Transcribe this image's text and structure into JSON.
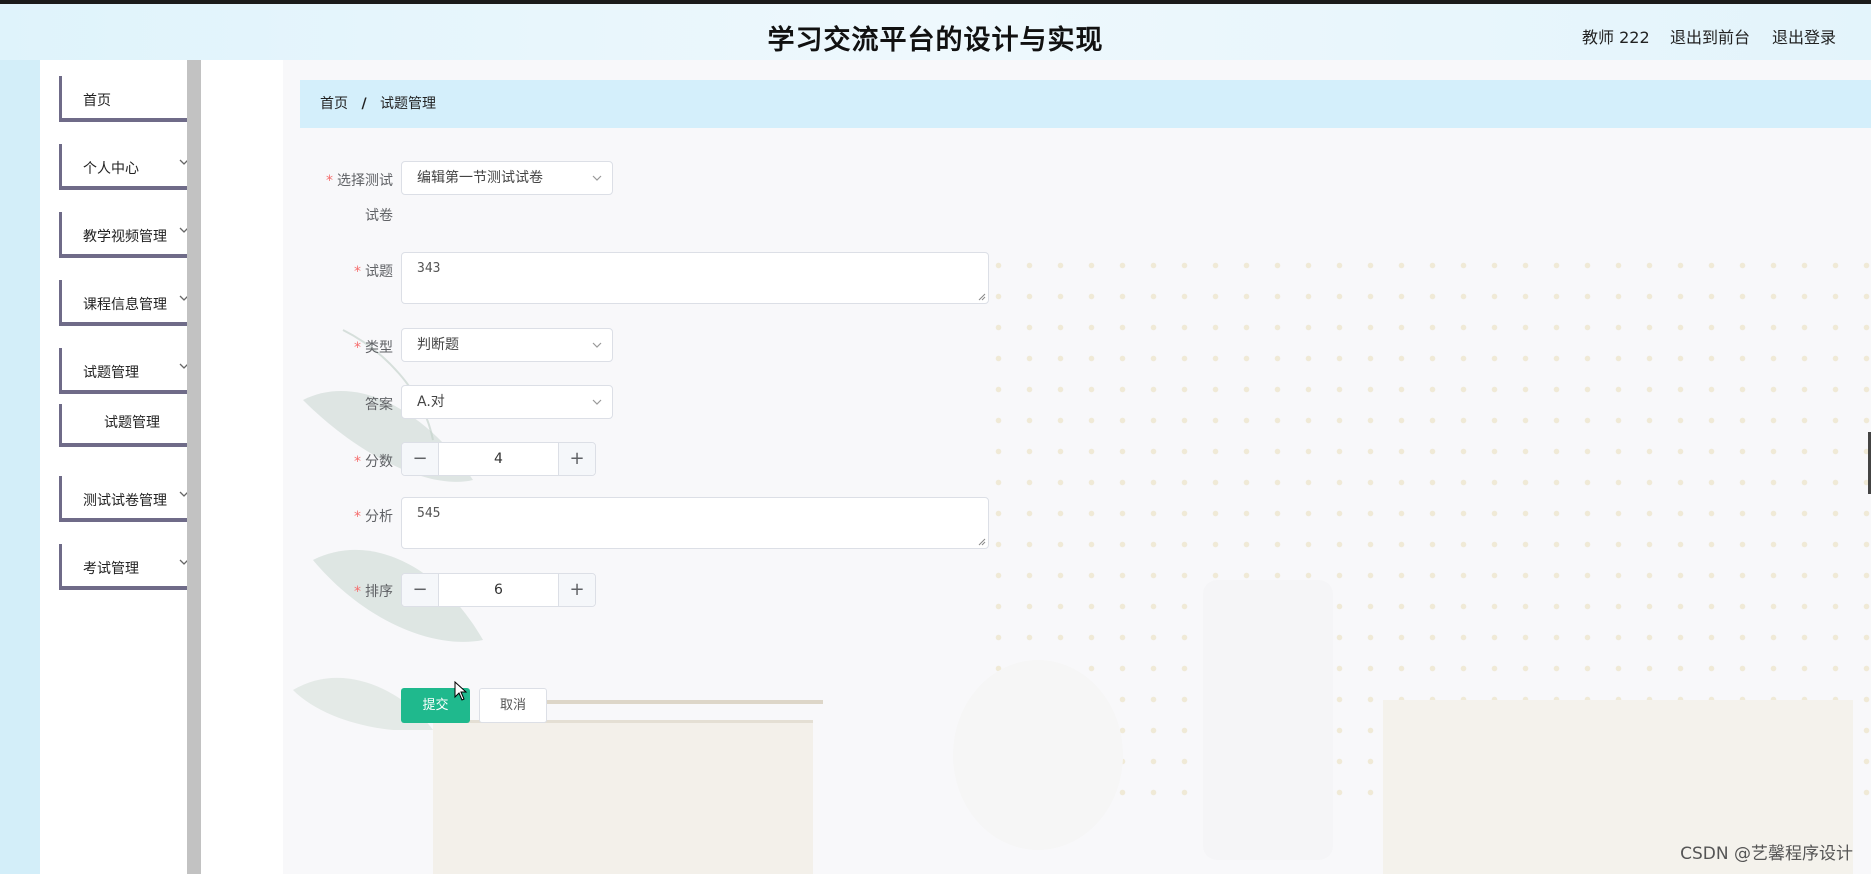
{
  "header": {
    "title": "学习交流平台的设计与实现",
    "user_label": "教师 222",
    "to_frontend": "退出到前台",
    "logout": "退出登录"
  },
  "sidebar": {
    "items": [
      {
        "label": "首页"
      },
      {
        "label": "个人中心"
      },
      {
        "label": "教学视频管理"
      },
      {
        "label": "课程信息管理"
      },
      {
        "label": "试题管理"
      },
      {
        "label": "试题管理"
      },
      {
        "label": "测试试卷管理"
      },
      {
        "label": "考试管理"
      }
    ]
  },
  "breadcrumb": {
    "home": "首页",
    "separator": "/",
    "current": "试题管理"
  },
  "form": {
    "paper": {
      "label_line1": "选择测试",
      "label_line2": "试卷",
      "value": "编辑第一节测试试卷"
    },
    "question": {
      "label": "试题",
      "value": "343"
    },
    "type": {
      "label": "类型",
      "value": "判断题"
    },
    "answer": {
      "label": "答案",
      "value": "A.对"
    },
    "score": {
      "label": "分数",
      "value": "4"
    },
    "analysis": {
      "label": "分析",
      "value": "545"
    },
    "order": {
      "label": "排序",
      "value": "6"
    },
    "required_mark": "*",
    "minus": "−",
    "plus": "+",
    "submit": "提交",
    "cancel": "取消"
  },
  "watermark": "CSDN @艺馨程序设计",
  "colors": {
    "primary": "#1fb98d",
    "required": "#f56c6c",
    "breadcrumb_bg": "#d4effb",
    "menu_border": "#6f6b88"
  }
}
